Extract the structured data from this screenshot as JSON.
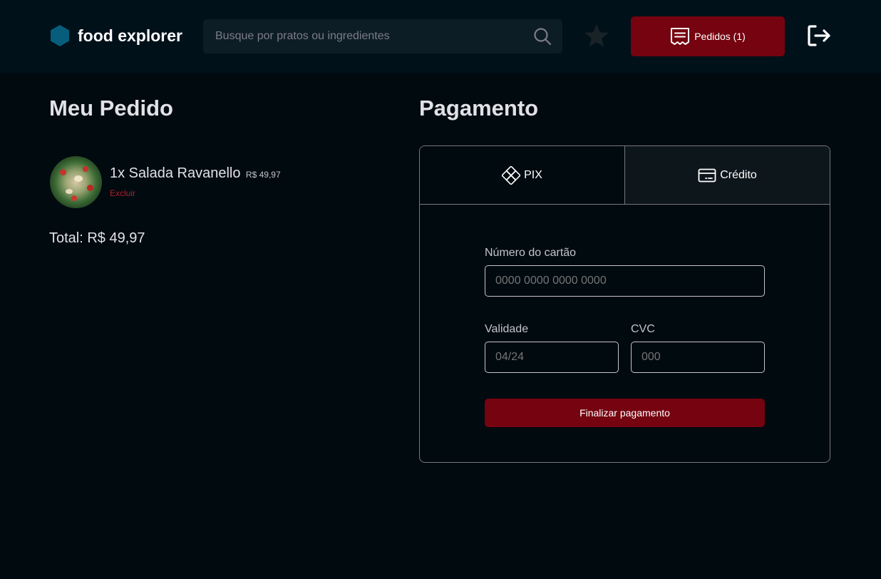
{
  "header": {
    "brand_name": "food explorer",
    "search_placeholder": "Busque por pratos ou ingredientes",
    "orders_label": "Pedidos (1)",
    "brand_color": "#065e7c",
    "accent_color": "#750310"
  },
  "icons": {
    "brand": "hexagon-logo-icon",
    "search": "search-icon",
    "favorites": "star-icon",
    "orders": "receipt-icon",
    "logout": "sign-out-icon",
    "pix": "pix-icon",
    "credit": "credit-card-icon"
  },
  "order": {
    "title": "Meu Pedido",
    "items": [
      {
        "quantity_name": "1x Salada Ravanello",
        "price": "R$ 49,97",
        "delete_label": "Excluir"
      }
    ],
    "total": "Total: R$ 49,97"
  },
  "payment": {
    "title": "Pagamento",
    "tabs": [
      {
        "label": "PIX"
      },
      {
        "label": "Crédito"
      }
    ],
    "form": {
      "card_number_label": "Número do cartão",
      "card_number_placeholder": "0000 0000 0000 0000",
      "expiry_label": "Validade",
      "expiry_placeholder": "04/24",
      "cvc_label": "CVC",
      "cvc_placeholder": "000",
      "submit_label": "Finalizar pagamento"
    }
  }
}
